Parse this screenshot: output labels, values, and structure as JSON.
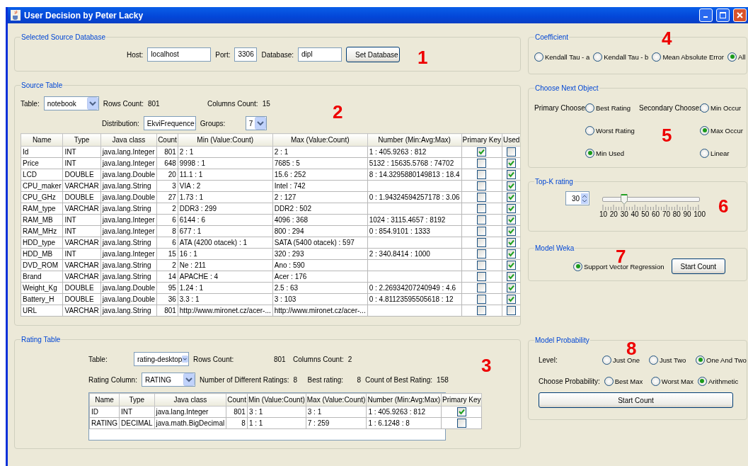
{
  "window": {
    "title": "User Decision by Peter Lacky"
  },
  "source_database": {
    "title": "Selected Source Database",
    "fields": [
      {
        "label": "Host:",
        "value": "localhost"
      },
      {
        "label": "Port:",
        "value": "3306"
      },
      {
        "label": "Database:",
        "value": "dipl"
      }
    ],
    "button": "Set Database"
  },
  "source_table": {
    "title": "Source Table",
    "table_label": "Table:",
    "table_value": "notebook",
    "rows_count_label": "Rows Count:",
    "rows_count": "801",
    "columns_count_label": "Columns Count:",
    "columns_count": "15",
    "distribution_label": "Distribution:",
    "distribution_value": "EkviFrequence",
    "groups_label": "Groups:",
    "groups_value": "7",
    "columns": [
      "Name",
      "Type",
      "Java class",
      "Count",
      "Min (Value:Count)",
      "Max (Value:Count)",
      "Number (Min:Avg:Max)",
      "Primary Key",
      "Used"
    ],
    "rows": [
      {
        "cells": [
          "Id",
          "INT",
          "java.lang.Integer",
          "801",
          "2 : 1",
          "2 : 1",
          "1 : 405.9263 : 812"
        ],
        "primary_key": true,
        "used": false
      },
      {
        "cells": [
          "Price",
          "INT",
          "java.lang.Integer",
          "648",
          "9998 : 1",
          "7685 : 5",
          "5132 : 15635.5768 : 74702"
        ],
        "primary_key": false,
        "used": true
      },
      {
        "cells": [
          "LCD",
          "DOUBLE",
          "java.lang.Double",
          "20",
          "11.1 : 1",
          "15.6 : 252",
          "8 : 14.3295880149813 : 18.4"
        ],
        "primary_key": false,
        "used": true
      },
      {
        "cells": [
          "CPU_maker",
          "VARCHAR",
          "java.lang.String",
          "3",
          "VIA : 2",
          "Intel : 742",
          ""
        ],
        "primary_key": false,
        "used": true
      },
      {
        "cells": [
          "CPU_GHz",
          "DOUBLE",
          "java.lang.Double",
          "27",
          "1.73 : 1",
          "2 : 127",
          "0 : 1.94324594257178 : 3.06"
        ],
        "primary_key": false,
        "used": true
      },
      {
        "cells": [
          "RAM_type",
          "VARCHAR",
          "java.lang.String",
          "2",
          "DDR3 : 299",
          "DDR2 : 502",
          ""
        ],
        "primary_key": false,
        "used": true
      },
      {
        "cells": [
          "RAM_MB",
          "INT",
          "java.lang.Integer",
          "6",
          "6144 : 6",
          "4096 : 368",
          "1024 : 3115.4657 : 8192"
        ],
        "primary_key": false,
        "used": true
      },
      {
        "cells": [
          "RAM_MHz",
          "INT",
          "java.lang.Integer",
          "8",
          "677 : 1",
          "800 : 294",
          "0 : 854.9101 : 1333"
        ],
        "primary_key": false,
        "used": true
      },
      {
        "cells": [
          "HDD_type",
          "VARCHAR",
          "java.lang.String",
          "6",
          "ATA (4200 otacek) : 1",
          "SATA (5400 otacek) : 597",
          ""
        ],
        "primary_key": false,
        "used": true
      },
      {
        "cells": [
          "HDD_MB",
          "INT",
          "java.lang.Integer",
          "15",
          "16 : 1",
          "320 : 293",
          "2 : 340.8414 : 1000"
        ],
        "primary_key": false,
        "used": true
      },
      {
        "cells": [
          "DVD_ROM",
          "VARCHAR",
          "java.lang.String",
          "2",
          "Ne : 211",
          "Ano : 590",
          ""
        ],
        "primary_key": false,
        "used": true
      },
      {
        "cells": [
          "Brand",
          "VARCHAR",
          "java.lang.String",
          "14",
          "APACHE : 4",
          "Acer : 176",
          ""
        ],
        "primary_key": false,
        "used": true
      },
      {
        "cells": [
          "Weight_Kg",
          "DOUBLE",
          "java.lang.Double",
          "95",
          "1.24 : 1",
          "2.5 : 63",
          "0 : 2.26934207240949 : 4.6"
        ],
        "primary_key": false,
        "used": true
      },
      {
        "cells": [
          "Battery_H",
          "DOUBLE",
          "java.lang.Double",
          "36",
          "3.3 : 1",
          "3 : 103",
          "0 : 4.81123595505618 : 12"
        ],
        "primary_key": false,
        "used": true
      },
      {
        "cells": [
          "URL",
          "VARCHAR",
          "java.lang.String",
          "801",
          "http://www.mironet.cz/acer-...",
          "http://www.mironet.cz/acer-...",
          ""
        ],
        "primary_key": false,
        "used": false
      }
    ]
  },
  "rating_table": {
    "title": "Rating Table",
    "table_label": "Table:",
    "table_value": "rating-desktop",
    "rows_count_label": "Rows Count:",
    "rows_count": "801",
    "columns_count_label": "Columns Count:",
    "columns_count": "2",
    "rating_column_label": "Rating Column:",
    "rating_column_value": "RATING",
    "different_label": "Number of Different Ratings:",
    "different_value": "8",
    "best_label": "Best rating:",
    "best_value": "8",
    "best_count_label": "Count of Best Rating:",
    "best_count_value": "158",
    "columns": [
      "Name",
      "Type",
      "Java class",
      "Count",
      "Min (Value:Count)",
      "Max (Value:Count)",
      "Number (Min:Avg:Max)",
      "Primary Key"
    ],
    "rows": [
      {
        "cells": [
          "ID",
          "INT",
          "java.lang.Integer",
          "801",
          "3 : 1",
          "3 : 1",
          "1 : 405.9263 : 812"
        ],
        "primary_key": true
      },
      {
        "cells": [
          "RATING",
          "DECIMAL",
          "java.math.BigDecimal",
          "8",
          "1 : 1",
          "7 : 259",
          "1 : 6.1248 : 8"
        ],
        "primary_key": false
      }
    ]
  },
  "coefficient": {
    "title": "Coefficient",
    "options": [
      {
        "label": "Kendall Tau - a",
        "selected": false
      },
      {
        "label": "Kendall Tau - b",
        "selected": false
      },
      {
        "label": "Mean Absolute Error",
        "selected": false
      },
      {
        "label": "All",
        "selected": true
      }
    ]
  },
  "choose_next_object": {
    "title": "Choose Next Object",
    "primary_label": "Primary Choose:",
    "primary_options": [
      {
        "label": "Best Rating",
        "selected": false
      },
      {
        "label": "Worst Rating",
        "selected": false
      },
      {
        "label": "Min Used",
        "selected": true
      }
    ],
    "secondary_label": "Secondary Choose:",
    "secondary_options": [
      {
        "label": "Min Occur",
        "selected": false
      },
      {
        "label": "Max Occur",
        "selected": true
      },
      {
        "label": "Linear",
        "selected": false
      }
    ]
  },
  "top_k": {
    "title": "Top-K rating",
    "value": "30",
    "level": 0.22,
    "ticks": [
      "10",
      "20",
      "30",
      "40",
      "50",
      "60",
      "70",
      "80",
      "90",
      "100"
    ]
  },
  "model_weka": {
    "title": "Model Weka",
    "options": [
      {
        "label": "Support Vector Regression",
        "selected": true
      }
    ],
    "button": "Start Count"
  },
  "model_probability": {
    "title": "Model Probability",
    "level_label": "Level:",
    "level_options": [
      {
        "label": "Just One",
        "selected": false
      },
      {
        "label": "Just Two",
        "selected": false
      },
      {
        "label": "One And Two",
        "selected": true
      }
    ],
    "probability_label": "Choose Probability:",
    "probability_options": [
      {
        "label": "Best Max",
        "selected": false
      },
      {
        "label": "Worst Max",
        "selected": false
      },
      {
        "label": "Arithmetic",
        "selected": true
      }
    ],
    "button": "Start Count"
  },
  "annotations": [
    "1",
    "2",
    "3",
    "4",
    "5",
    "6",
    "7",
    "8"
  ]
}
